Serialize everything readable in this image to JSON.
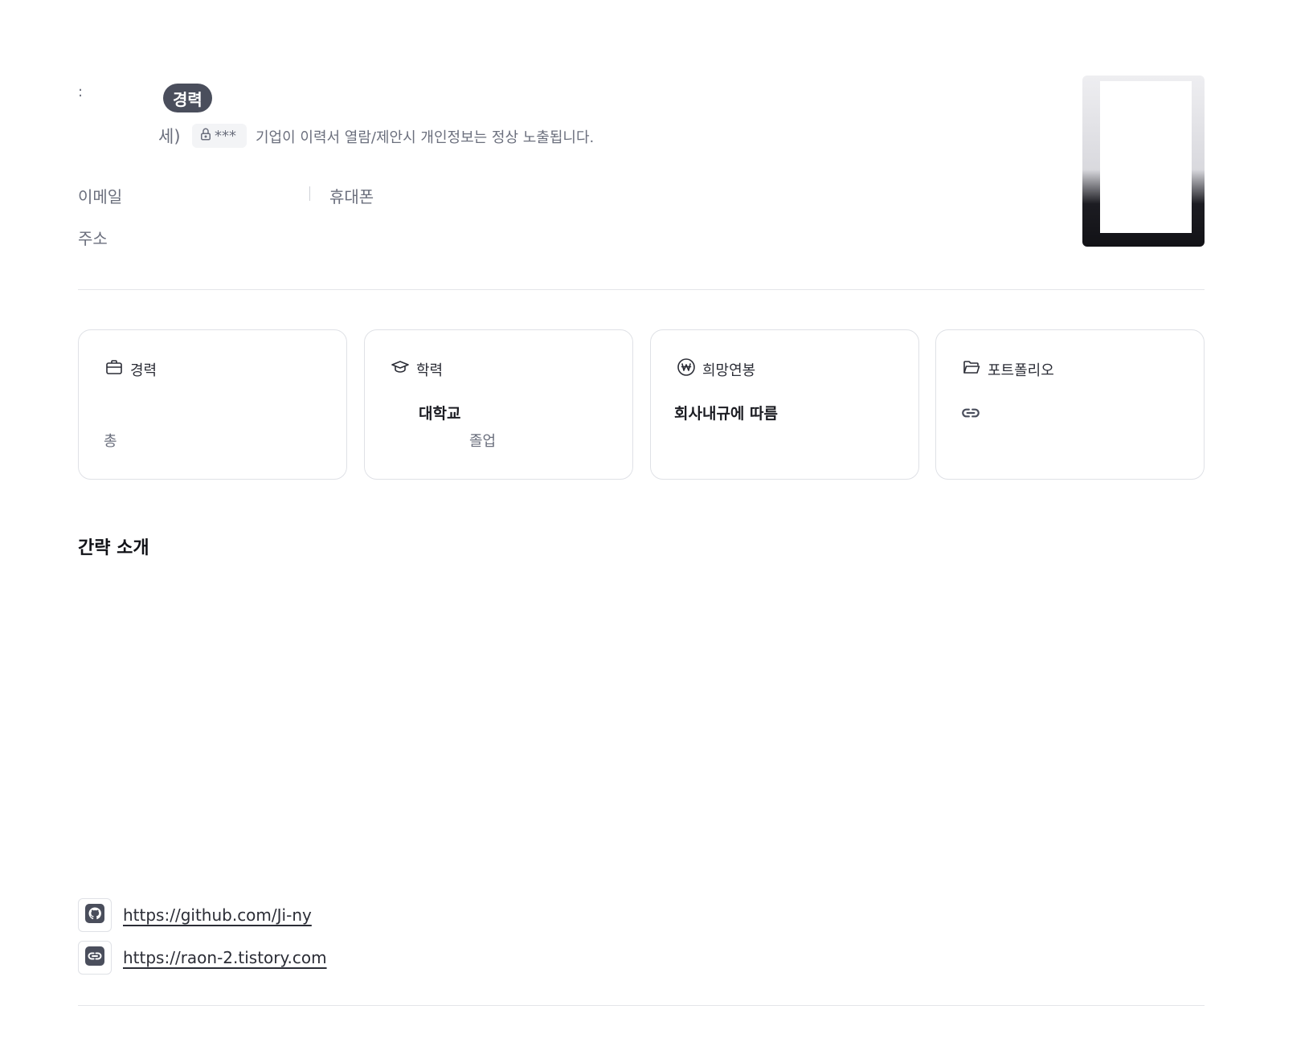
{
  "header": {
    "name_mark": ":",
    "career_badge": "경력",
    "age_fragment": "세)",
    "privacy_mask": "***",
    "privacy_note": "기업이 이력서 열람/제안시 개인정보는 정상 노출됩니다."
  },
  "contact": {
    "email_label": "이메일",
    "phone_label": "휴대폰",
    "address_label": "주소"
  },
  "cards": [
    {
      "title": "경력",
      "icon": "briefcase-icon",
      "sub": "총"
    },
    {
      "title": "학력",
      "icon": "graduation-cap-icon",
      "value": "대학교",
      "sub": "졸업"
    },
    {
      "title": "희망연봉",
      "icon": "won-icon",
      "value": "회사내규에 따름"
    },
    {
      "title": "포트폴리오",
      "icon": "folder-icon",
      "link_icon": "link-icon"
    }
  ],
  "intro": {
    "title": "간략 소개"
  },
  "links": [
    {
      "icon": "github-icon",
      "url": "https://github.com/Ji-ny"
    },
    {
      "icon": "link-icon",
      "url": "https://raon-2.tistory.com"
    }
  ],
  "colors": {
    "badge_bg": "#4a4e5c",
    "muted_text": "#6b6f7d",
    "card_border": "#dfe1e6"
  }
}
